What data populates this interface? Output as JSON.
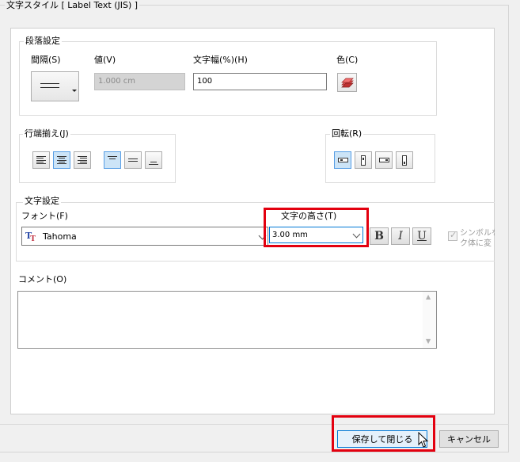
{
  "window": {
    "group_title": "文字スタイル [ Label Text (JIS) ]"
  },
  "paragraph": {
    "title": "段落設定",
    "spacing_label": "間隔(S)",
    "value_label": "値(V)",
    "value": "1.000 cm",
    "width_label": "文字幅(%)(H)",
    "width_value": "100",
    "color_label": "色(C)"
  },
  "justify": {
    "title": "行端揃え(J)"
  },
  "rotation": {
    "title": "回転(R)"
  },
  "text": {
    "title": "文字設定",
    "font_label": "フォント(F)",
    "font_value": "Tahoma",
    "height_label": "文字の高さ(T)",
    "height_value": "3.00 mm",
    "bold": "B",
    "italic": "I",
    "underline": "U",
    "symbol_label_1": "シンボルを",
    "symbol_label_2": "ク体に変"
  },
  "comment": {
    "label": "コメント(O)",
    "value": ""
  },
  "buttons": {
    "save_close": "保存して閉じる",
    "cancel": "キャンセル"
  },
  "colors": {
    "highlight": "#e3000f",
    "selected": "#cce4f7"
  }
}
